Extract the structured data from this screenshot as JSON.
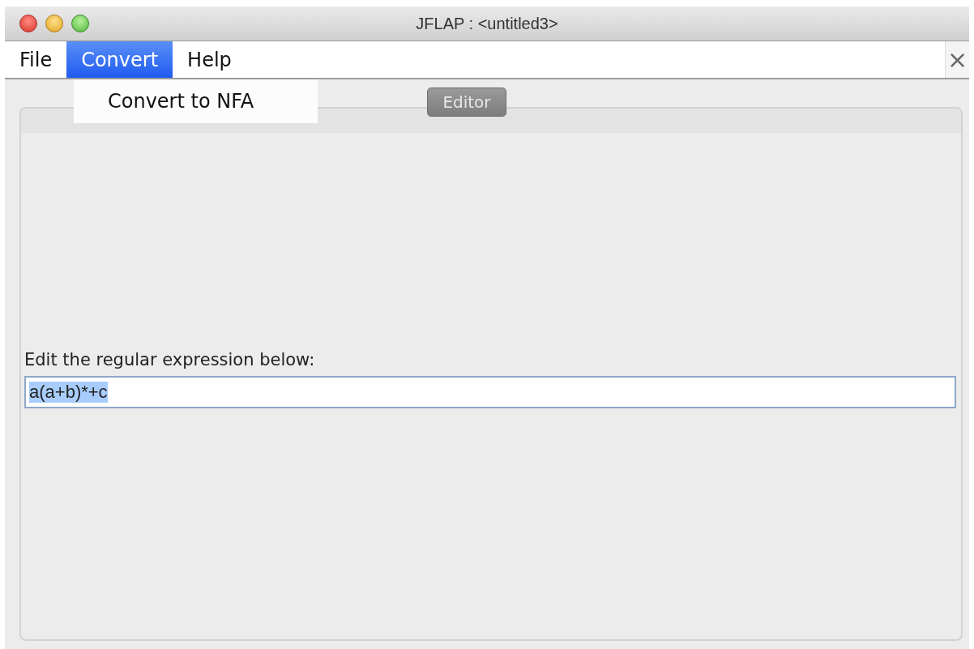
{
  "window": {
    "title": "JFLAP : <untitled3>"
  },
  "menu_bar": {
    "items": [
      {
        "label": "File",
        "selected": false
      },
      {
        "label": "Convert",
        "selected": true
      },
      {
        "label": "Help",
        "selected": false
      }
    ],
    "close_label": "×"
  },
  "open_menu": {
    "items": [
      {
        "label": "Convert to NFA"
      }
    ]
  },
  "tabs": [
    {
      "label": "Editor",
      "selected": true
    }
  ],
  "editor": {
    "label": "Edit the regular expression below:",
    "value": "a(a+b)*+c",
    "value_selected": true
  }
}
